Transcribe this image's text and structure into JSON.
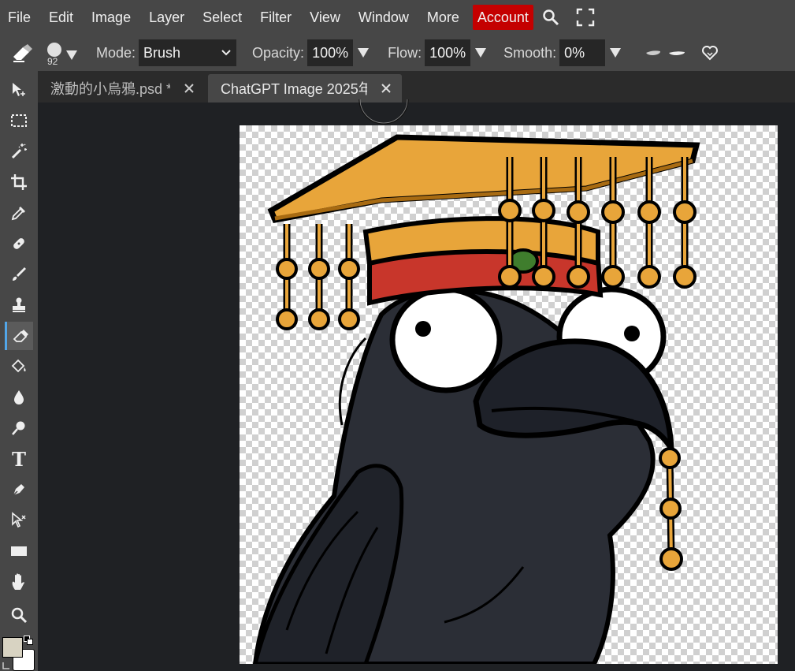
{
  "menu": {
    "items": [
      "File",
      "Edit",
      "Image",
      "Layer",
      "Select",
      "Filter",
      "View",
      "Window",
      "More"
    ],
    "account_label": "Account",
    "icons": [
      "search-icon",
      "fullscreen-icon"
    ],
    "account_color": "#c40000"
  },
  "options": {
    "tool_icon": "eraser-icon",
    "brush_size": "92",
    "mode_label": "Mode:",
    "mode_value": "Brush",
    "opacity_label": "Opacity:",
    "opacity_value": "100%",
    "flow_label": "Flow:",
    "flow_value": "100%",
    "smooth_label": "Smooth:",
    "smooth_value": "0%"
  },
  "tools": [
    "move-icon",
    "marquee-icon",
    "magic-wand-icon",
    "crop-icon",
    "eyedropper-icon",
    "healing-icon",
    "brush-icon",
    "stamp-icon",
    "eraser-icon",
    "bucket-icon",
    "blur-icon",
    "dodge-icon",
    "text-icon",
    "pen-icon",
    "path-select-icon",
    "shape-icon",
    "hand-icon",
    "zoom-icon"
  ],
  "active_tool": "eraser-icon",
  "tabs": [
    {
      "title": "激動的小烏鴉.psd *",
      "active": false
    },
    {
      "title": "ChatGPT Image 2025年",
      "active": true
    }
  ],
  "colors": {
    "foreground": "#d8d3c2",
    "background": "#ffffff"
  }
}
